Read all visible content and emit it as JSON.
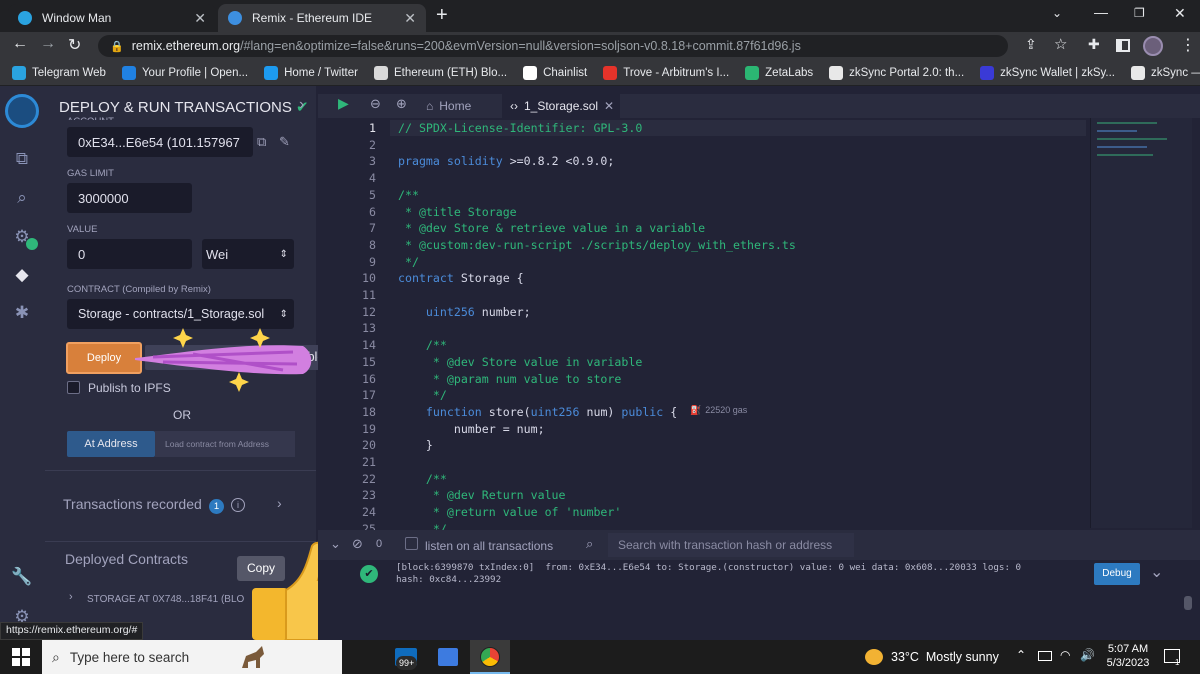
{
  "browser": {
    "tabs": [
      {
        "title": "Window Man",
        "active": false
      },
      {
        "title": "Remix - Ethereum IDE",
        "active": true
      }
    ],
    "url_host": "remix.ethereum.org",
    "url_rest": "/#lang=en&optimize=false&runs=200&evmVersion=null&version=soljson-v0.8.18+commit.87f61d96.js",
    "bookmarks": [
      {
        "label": "Telegram Web",
        "color": "#2aa3e0"
      },
      {
        "label": "Your Profile | Open...",
        "color": "#2081e2"
      },
      {
        "label": "Home / Twitter",
        "color": "#1d9bf0"
      },
      {
        "label": "Ethereum (ETH) Blo...",
        "color": "#d9d9d9"
      },
      {
        "label": "Chainlist",
        "color": "#ffffff"
      },
      {
        "label": "Trove - Arbitrum's I...",
        "color": "#e5332a"
      },
      {
        "label": "ZetaLabs",
        "color": "#2bb673"
      },
      {
        "label": "zkSync Portal 2.0: th...",
        "color": "#e8e8e8"
      },
      {
        "label": "zkSync Wallet | zkSy...",
        "color": "#3a3ad6"
      },
      {
        "label": "zkSync — Rely on...",
        "color": "#e8e8e8"
      }
    ],
    "status_url": "https://remix.ethereum.org/#"
  },
  "panel": {
    "title": "DEPLOY & RUN TRANSACTIONS",
    "account_label": "ACCOUNT",
    "account_value": "0xE34...E6e54 (101.157967",
    "gas_limit_label": "GAS LIMIT",
    "gas_limit_value": "3000000",
    "value_label": "VALUE",
    "value_amount": "0",
    "value_unit": "Wei",
    "contract_label": "CONTRACT",
    "contract_note": "(Compiled by Remix)",
    "contract_value": "Storage - contracts/1_Storage.sol",
    "deploy_label": "Deploy",
    "deploy_hint": "ble)",
    "publish_label": "Publish to IPFS",
    "or_label": "OR",
    "at_address_label": "At Address",
    "load_placeholder": "Load contract from Address",
    "transactions_label": "Transactions recorded",
    "transactions_count": "1",
    "deployed_label": "Deployed Contracts",
    "copy_tooltip": "Copy",
    "deployed_item": "STORAGE AT 0X748...18F41 (BLO"
  },
  "editor": {
    "home_tab": "Home",
    "file_tab": "1_Storage.sol",
    "lines": [
      {
        "n": "1",
        "segs": [
          [
            "cm",
            "// SPDX-License-Identifier: GPL-3.0"
          ]
        ]
      },
      {
        "n": "2",
        "segs": []
      },
      {
        "n": "3",
        "segs": [
          [
            "kw",
            "pragma solidity "
          ],
          [
            "tx",
            ">=0.8.2 <0.9.0;"
          ]
        ]
      },
      {
        "n": "4",
        "segs": []
      },
      {
        "n": "5",
        "segs": [
          [
            "cm",
            "/**"
          ]
        ]
      },
      {
        "n": "6",
        "segs": [
          [
            "cm",
            " * @title Storage"
          ]
        ]
      },
      {
        "n": "7",
        "segs": [
          [
            "cm",
            " * @dev Store & retrieve value in a variable"
          ]
        ]
      },
      {
        "n": "8",
        "segs": [
          [
            "cm",
            " * @custom:dev-run-script ./scripts/deploy_with_ethers.ts"
          ]
        ]
      },
      {
        "n": "9",
        "segs": [
          [
            "cm",
            " */"
          ]
        ]
      },
      {
        "n": "10",
        "segs": [
          [
            "kw",
            "contract "
          ],
          [
            "tx",
            "Storage {"
          ]
        ]
      },
      {
        "n": "11",
        "segs": []
      },
      {
        "n": "12",
        "segs": [
          [
            "tx",
            "    "
          ],
          [
            "ty",
            "uint256 "
          ],
          [
            "tx",
            "number;"
          ]
        ]
      },
      {
        "n": "13",
        "segs": []
      },
      {
        "n": "14",
        "segs": [
          [
            "cm",
            "    /**"
          ]
        ]
      },
      {
        "n": "15",
        "segs": [
          [
            "cm",
            "     * @dev Store value in variable"
          ]
        ]
      },
      {
        "n": "16",
        "segs": [
          [
            "cm",
            "     * @param num value to store"
          ]
        ]
      },
      {
        "n": "17",
        "segs": [
          [
            "cm",
            "     */"
          ]
        ]
      },
      {
        "n": "18",
        "segs": [
          [
            "tx",
            "    "
          ],
          [
            "kw",
            "function "
          ],
          [
            "tx",
            "store("
          ],
          [
            "ty",
            "uint256 "
          ],
          [
            "tx",
            "num) "
          ],
          [
            "kw",
            "public "
          ],
          [
            "tx",
            "{"
          ]
        ]
      },
      {
        "n": "19",
        "segs": [
          [
            "tx",
            "        number = num;"
          ]
        ]
      },
      {
        "n": "20",
        "segs": [
          [
            "tx",
            "    }"
          ]
        ]
      },
      {
        "n": "21",
        "segs": []
      },
      {
        "n": "22",
        "segs": [
          [
            "cm",
            "    /**"
          ]
        ]
      },
      {
        "n": "23",
        "segs": [
          [
            "cm",
            "     * @dev Return value"
          ]
        ]
      },
      {
        "n": "24",
        "segs": [
          [
            "cm",
            "     * @return value of 'number'"
          ]
        ]
      },
      {
        "n": "25",
        "segs": [
          [
            "cm",
            "     */"
          ]
        ]
      }
    ],
    "gas_hint": "22520 gas"
  },
  "terminal": {
    "pending_count": "0",
    "listen_label": "listen on all transactions",
    "search_placeholder": "Search with transaction hash or address",
    "log_line1": "[block:6399870 txIndex:0]  from: 0xE34...E6e54 to: Storage.(constructor) value: 0 wei data: 0x608...20033 logs: 0",
    "log_line2": "hash: 0xc84...23992",
    "debug_label": "Debug"
  },
  "taskbar": {
    "search_placeholder": "Type here to search",
    "mail_badge": "99+",
    "weather": "33°C  Mostly sunny",
    "time": "5:07 AM",
    "date": "5/3/2023",
    "notif_count": "1"
  }
}
